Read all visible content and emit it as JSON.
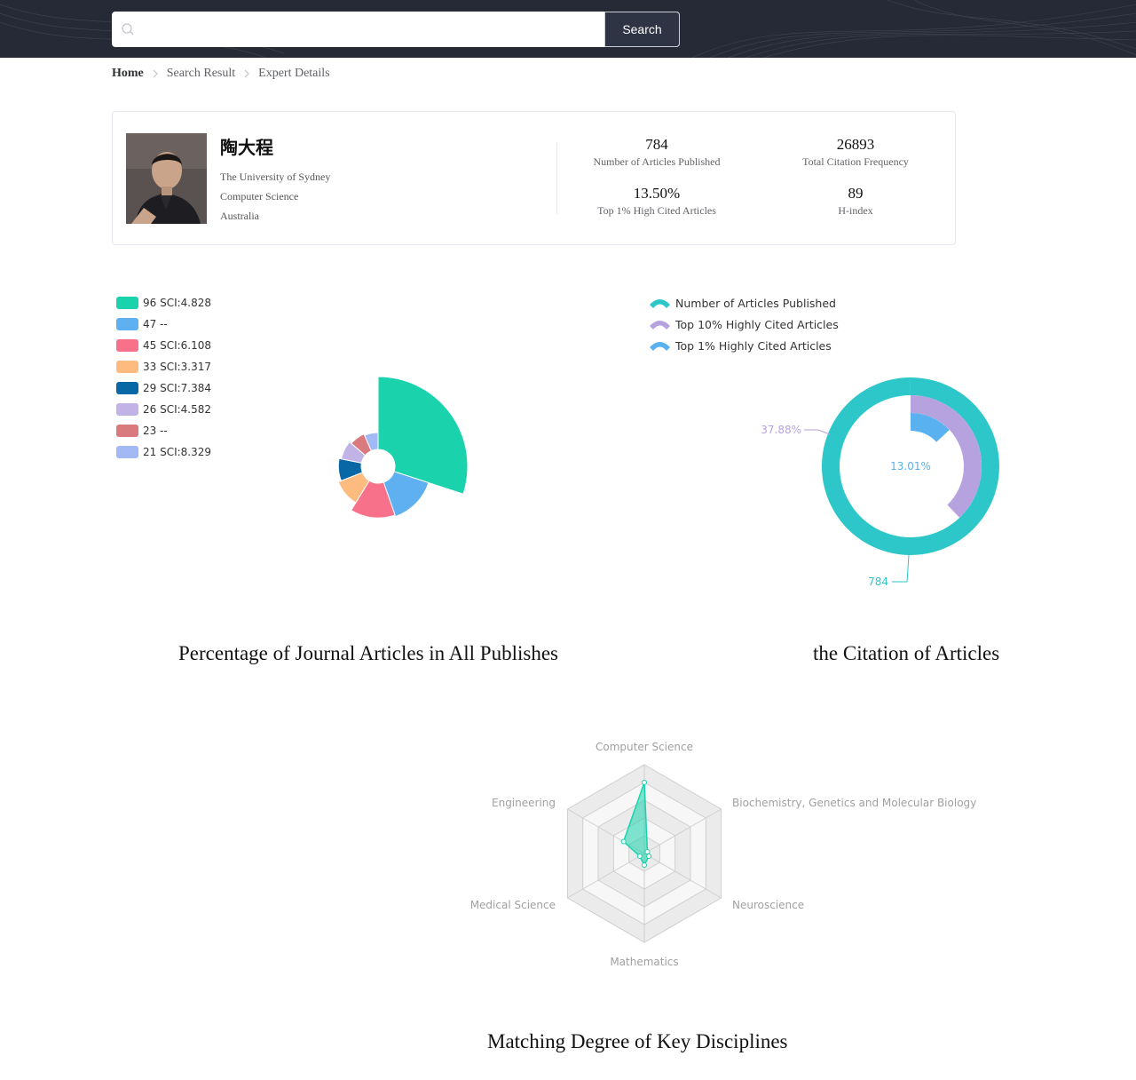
{
  "search": {
    "placeholder": "",
    "value": "",
    "button_label": "Search"
  },
  "breadcrumb": {
    "items": [
      "Home",
      "Search Result",
      "Expert Details"
    ]
  },
  "expert": {
    "name": "陶大程",
    "affiliation": "The University of Sydney",
    "field": "Computer Science",
    "country": "Australia"
  },
  "stats": [
    {
      "value": "784",
      "label": "Number of Articles Published"
    },
    {
      "value": "26893",
      "label": "Total Citation Frequency"
    },
    {
      "value": "13.50%",
      "label": "Top 1% High Cited Articles"
    },
    {
      "value": "89",
      "label": "H-index"
    }
  ],
  "charts": {
    "journal_caption": "Percentage of Journal Articles in All Publishes",
    "citation_caption": "the Citation of Articles",
    "radar_caption": "Matching Degree of Key Disciplines"
  },
  "chart_data": [
    {
      "type": "pie",
      "subtype": "rose",
      "legend_position": "top-left",
      "categories": [
        "96 SCI:4.828",
        "47 --",
        "45 SCI:6.108",
        "33 SCI:3.317",
        "29 SCI:7.384",
        "26 SCI:4.582",
        "23 --",
        "21 SCI:8.329"
      ],
      "values": [
        96,
        47,
        45,
        33,
        29,
        26,
        23,
        21
      ],
      "colors": [
        "#1ad3ad",
        "#5eb0f0",
        "#f7718a",
        "#fdbb80",
        "#0a67a5",
        "#c2b3e6",
        "#d97a7f",
        "#a3b9f5"
      ]
    },
    {
      "type": "pie",
      "subtype": "multi-ring-donut",
      "legend_position": "top-left",
      "series": [
        {
          "name": "Number of Articles Published",
          "value": 784,
          "percent": 100,
          "label": "784",
          "color": "#2ec7c9"
        },
        {
          "name": "Top 10% Highly Cited Articles",
          "percent": 37.88,
          "label": "37.88%",
          "color": "#b6a2de"
        },
        {
          "name": "Top 1% Highly Cited Articles",
          "percent": 13.01,
          "label": "13.01%",
          "color": "#5ab1ef"
        }
      ]
    },
    {
      "type": "radar",
      "indicators": [
        "Computer Science",
        "Biochemistry, Genetics and Molecular Biology",
        "Neuroscience",
        "Mathematics",
        "Medical Science",
        "Engineering"
      ],
      "values": [
        0.8,
        0.04,
        0.06,
        0.13,
        0.06,
        0.27
      ],
      "max": 1,
      "color": "#1ad3ad"
    }
  ]
}
